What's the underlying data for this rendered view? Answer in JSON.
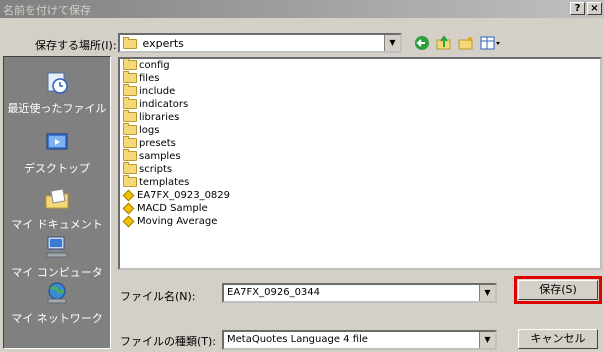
{
  "window": {
    "title": "名前を付けて保存",
    "help_label": "?",
    "close_label": "×"
  },
  "location": {
    "label": "保存する場所(I):",
    "value": "experts"
  },
  "toolbar": {
    "icons": [
      "back-icon",
      "up-folder-icon",
      "new-folder-icon",
      "view-menu-icon"
    ]
  },
  "places": [
    {
      "label": "最近使ったファイル",
      "icon": "recent-files-icon"
    },
    {
      "label": "デスクトップ",
      "icon": "desktop-icon"
    },
    {
      "label": "マイ ドキュメント",
      "icon": "my-documents-icon"
    },
    {
      "label": "マイ コンピュータ",
      "icon": "my-computer-icon"
    },
    {
      "label": "マイ ネットワーク",
      "icon": "my-network-icon"
    }
  ],
  "files": [
    {
      "name": "config",
      "type": "folder"
    },
    {
      "name": "files",
      "type": "folder"
    },
    {
      "name": "include",
      "type": "folder"
    },
    {
      "name": "indicators",
      "type": "folder"
    },
    {
      "name": "libraries",
      "type": "folder"
    },
    {
      "name": "logs",
      "type": "folder"
    },
    {
      "name": "presets",
      "type": "folder"
    },
    {
      "name": "samples",
      "type": "folder"
    },
    {
      "name": "scripts",
      "type": "folder"
    },
    {
      "name": "templates",
      "type": "folder"
    },
    {
      "name": "EA7FX_0923_0829",
      "type": "expert"
    },
    {
      "name": "MACD Sample",
      "type": "expert"
    },
    {
      "name": "Moving Average",
      "type": "expert"
    }
  ],
  "filename": {
    "label": "ファイル名(N):",
    "value": "EA7FX_0926_0344"
  },
  "filetype": {
    "label": "ファイルの種類(T):",
    "value": "MetaQuotes Language 4 file"
  },
  "buttons": {
    "save": "保存(S)",
    "cancel": "キャンセル"
  },
  "colors": {
    "highlight": "#e00000",
    "places_bg": "#808080"
  }
}
